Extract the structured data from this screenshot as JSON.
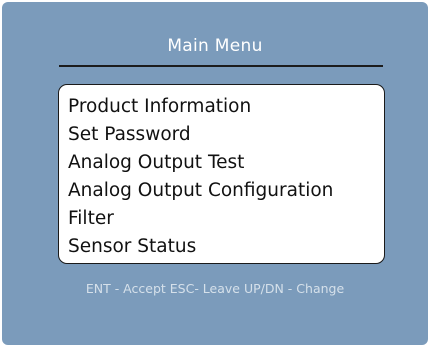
{
  "menu": {
    "title": "Main Menu",
    "items": [
      {
        "label": "Product Information"
      },
      {
        "label": "Set Password"
      },
      {
        "label": "Analog Output Test"
      },
      {
        "label": "Analog Output Configuration"
      },
      {
        "label": "Filter"
      },
      {
        "label": "Sensor Status"
      }
    ]
  },
  "footer": {
    "help_text": "ENT - Accept ESC- Leave UP/DN - Change"
  },
  "colors": {
    "screen_background": "#7b9bbb",
    "menu_background": "#ffffff",
    "title_text": "#ffffff",
    "help_text": "#d5e0ea"
  }
}
